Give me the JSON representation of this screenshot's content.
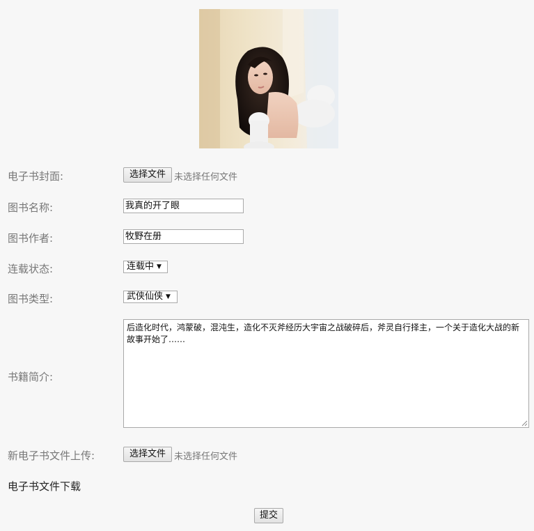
{
  "cover": {
    "alt": "电子书封面图片"
  },
  "form": {
    "cover_label": "电子书封面:",
    "cover_button": "选择文件",
    "cover_note": "未选择任何文件",
    "title_label": "图书名称:",
    "title_value": "我真的开了眼",
    "author_label": "图书作者:",
    "author_value": "牧野在册",
    "status_label": "连载状态:",
    "status_value": "连载中",
    "type_label": "图书类型:",
    "type_value": "武侠仙侠",
    "intro_label": "书籍简介:",
    "intro_value": "后造化时代，鸿蒙破，混沌生，造化不灭斧经历大宇宙之战破碎后，斧灵自行择主，一个关于造化大战的新故事开始了……",
    "upload_label": "新电子书文件上传:",
    "upload_button": "选择文件",
    "upload_note": "未选择任何文件",
    "download_label": "电子书文件下载",
    "submit_label": "提交"
  }
}
